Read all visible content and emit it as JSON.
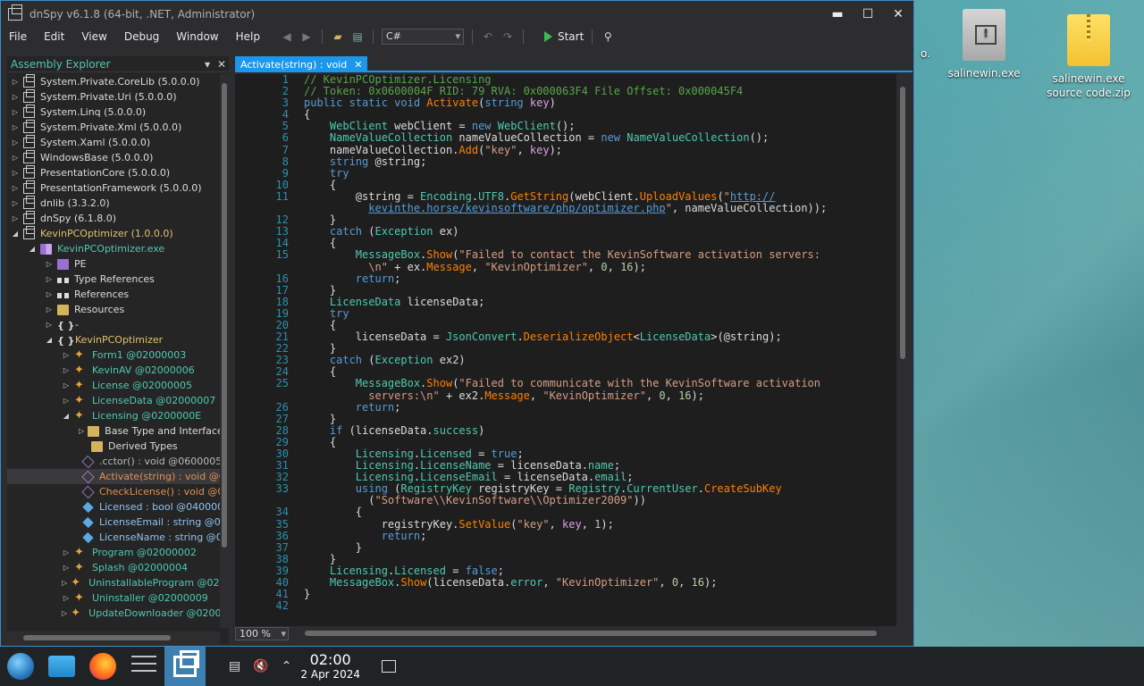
{
  "window": {
    "title": "dnSpy v6.1.8 (64-bit, .NET, Administrator)",
    "minimize": "▬",
    "maximize": "☐",
    "close": "✕"
  },
  "menu": [
    "File",
    "Edit",
    "View",
    "Debug",
    "Window",
    "Help"
  ],
  "toolbar": {
    "language": "C#",
    "start_label": "Start"
  },
  "explorer": {
    "title": "Assembly Explorer",
    "close": "✕",
    "nodes": [
      {
        "label": "System.Private.CoreLib (5.0.0.0)",
        "indent": 0,
        "arrow": "▷",
        "icon": "asm",
        "style": ""
      },
      {
        "label": "System.Private.Uri (5.0.0.0)",
        "indent": 0,
        "arrow": "▷",
        "icon": "asm",
        "style": ""
      },
      {
        "label": "System.Linq (5.0.0.0)",
        "indent": 0,
        "arrow": "▷",
        "icon": "asm",
        "style": ""
      },
      {
        "label": "System.Private.Xml (5.0.0.0)",
        "indent": 0,
        "arrow": "▷",
        "icon": "asm",
        "style": ""
      },
      {
        "label": "System.Xaml (5.0.0.0)",
        "indent": 0,
        "arrow": "▷",
        "icon": "asm",
        "style": ""
      },
      {
        "label": "WindowsBase (5.0.0.0)",
        "indent": 0,
        "arrow": "▷",
        "icon": "asm",
        "style": ""
      },
      {
        "label": "PresentationCore (5.0.0.0)",
        "indent": 0,
        "arrow": "▷",
        "icon": "asm",
        "style": ""
      },
      {
        "label": "PresentationFramework (5.0.0.0)",
        "indent": 0,
        "arrow": "▷",
        "icon": "asm",
        "style": ""
      },
      {
        "label": "dnlib (3.3.2.0)",
        "indent": 0,
        "arrow": "▷",
        "icon": "asm",
        "style": ""
      },
      {
        "label": "dnSpy (6.1.8.0)",
        "indent": 0,
        "arrow": "▷",
        "icon": "asm",
        "style": ""
      },
      {
        "label": "KevinPCOptimizer (1.0.0.0)",
        "indent": 0,
        "arrow": "◢",
        "icon": "asm",
        "style": "yel"
      },
      {
        "label": "KevinPCOptimizer.exe",
        "indent": 1,
        "arrow": "◢",
        "icon": "mod",
        "style": "mod"
      },
      {
        "label": "PE",
        "indent": 2,
        "arrow": "▷",
        "icon": "pe",
        "style": ""
      },
      {
        "label": "Type References",
        "indent": 2,
        "arrow": "▷",
        "icon": "ref",
        "style": ""
      },
      {
        "label": "References",
        "indent": 2,
        "arrow": "▷",
        "icon": "ref",
        "style": ""
      },
      {
        "label": "Resources",
        "indent": 2,
        "arrow": "▷",
        "icon": "folder",
        "style": ""
      },
      {
        "label": "-",
        "indent": 2,
        "arrow": "▷",
        "icon": "ns",
        "style": ""
      },
      {
        "label": "KevinPCOptimizer",
        "indent": 2,
        "arrow": "◢",
        "icon": "ns",
        "style": "yel"
      },
      {
        "label": "Form1 @02000003",
        "indent": 3,
        "arrow": "▷",
        "icon": "class",
        "style": "cls"
      },
      {
        "label": "KevinAV @02000006",
        "indent": 3,
        "arrow": "▷",
        "icon": "class",
        "style": "cls"
      },
      {
        "label": "License @02000005",
        "indent": 3,
        "arrow": "▷",
        "icon": "class",
        "style": "cls"
      },
      {
        "label": "LicenseData @02000007",
        "indent": 3,
        "arrow": "▷",
        "icon": "class",
        "style": "cls"
      },
      {
        "label": "Licensing @0200000E",
        "indent": 3,
        "arrow": "◢",
        "icon": "class",
        "style": "cls"
      },
      {
        "label": "Base Type and Interfaces",
        "indent": 4,
        "arrow": "▷",
        "icon": "folder",
        "style": ""
      },
      {
        "label": "Derived Types",
        "indent": 4,
        "arrow": "",
        "icon": "folder",
        "style": ""
      },
      {
        "label": ".cctor() : void @06000050",
        "indent": 4,
        "arrow": "",
        "icon": "method",
        "style": "gray"
      },
      {
        "label": "Activate(string) : void @0600004F",
        "indent": 4,
        "arrow": "",
        "icon": "method",
        "style": "orange",
        "selected": true
      },
      {
        "label": "CheckLicense() : void @0600004E",
        "indent": 4,
        "arrow": "",
        "icon": "method",
        "style": "orange"
      },
      {
        "label": "Licensed : bool @04000025",
        "indent": 4,
        "arrow": "",
        "icon": "field",
        "style": "field"
      },
      {
        "label": "LicenseEmail : string @04000027",
        "indent": 4,
        "arrow": "",
        "icon": "field",
        "style": "field"
      },
      {
        "label": "LicenseName : string @04000026",
        "indent": 4,
        "arrow": "",
        "icon": "field",
        "style": "field"
      },
      {
        "label": "Program @02000002",
        "indent": 3,
        "arrow": "▷",
        "icon": "class",
        "style": "cls"
      },
      {
        "label": "Splash @02000004",
        "indent": 3,
        "arrow": "▷",
        "icon": "class",
        "style": "cls"
      },
      {
        "label": "UninstallableProgram @0200000A",
        "indent": 3,
        "arrow": "▷",
        "icon": "class",
        "style": "cls"
      },
      {
        "label": "Uninstaller @02000009",
        "indent": 3,
        "arrow": "▷",
        "icon": "class",
        "style": "cls"
      },
      {
        "label": "UpdateDownloader @0200000B",
        "indent": 3,
        "arrow": "▷",
        "icon": "class",
        "style": "cls"
      }
    ]
  },
  "tab": {
    "label": "Activate(string) : void",
    "close": "✕"
  },
  "editor": {
    "zoom": "100 %",
    "lines": [
      {
        "n": "1",
        "html": "<span class='cm'>// KevinPCOptimizer.Licensing</span>"
      },
      {
        "n": "2",
        "html": "<span class='cm'>// Token: 0x0600004F RID: 79 RVA: 0x000063F4 File Offset: 0x000045F4</span>"
      },
      {
        "n": "3",
        "html": "<span class='k'>public static void</span> <span class='mo'>Activate</span>(<span class='k'>string</span> <span class='p'>key</span>)"
      },
      {
        "n": "4",
        "html": "{"
      },
      {
        "n": "5",
        "html": "    <span class='t'>WebClient</span> webClient = <span class='k'>new</span> <span class='t'>WebClient</span>();"
      },
      {
        "n": "6",
        "html": "    <span class='t'>NameValueCollection</span> nameValueCollection = <span class='k'>new</span> <span class='t'>NameValueCollection</span>();"
      },
      {
        "n": "7",
        "html": "    nameValueCollection.<span class='mo'>Add</span>(<span class='s'>\"key\"</span>, <span class='p'>key</span>);"
      },
      {
        "n": "8",
        "html": "    <span class='k'>string</span> @string;"
      },
      {
        "n": "9",
        "html": "    <span class='k'>try</span>"
      },
      {
        "n": "10",
        "html": "    {"
      },
      {
        "n": "11",
        "html": "        @string = <span class='t'>Encoding</span>.<span class='prop'>UTF8</span>.<span class='mo'>GetString</span>(webClient.<span class='mo'>UploadValues</span>(<span class='s'>\"</span><span class='url'>http://</span>"
      },
      {
        "n": "",
        "html": "          <span class='url'>kevinthe.horse/kevinsoftware/php/optimizer.php</span><span class='s'>\"</span>, nameValueCollection));"
      },
      {
        "n": "12",
        "html": "    }"
      },
      {
        "n": "13",
        "html": "    <span class='k'>catch</span> (<span class='t'>Exception</span> ex)"
      },
      {
        "n": "14",
        "html": "    {"
      },
      {
        "n": "15",
        "html": "        <span class='t'>MessageBox</span>.<span class='mo'>Show</span>(<span class='s'>\"Failed to contact the KevinSoftware activation servers:</span>"
      },
      {
        "n": "",
        "html": "          <span class='s'>\\n\"</span> + ex.<span class='mo'>Message</span>, <span class='s'>\"KevinOptimizer\"</span>, <span class='n'>0</span>, <span class='n'>16</span>);"
      },
      {
        "n": "16",
        "html": "        <span class='k'>return</span>;"
      },
      {
        "n": "17",
        "html": "    }"
      },
      {
        "n": "18",
        "html": "    <span class='t'>LicenseData</span> licenseData;"
      },
      {
        "n": "19",
        "html": "    <span class='k'>try</span>"
      },
      {
        "n": "20",
        "html": "    {"
      },
      {
        "n": "21",
        "html": "        licenseData = <span class='t'>JsonConvert</span>.<span class='mo'>DeserializeObject</span>&lt;<span class='t'>LicenseData</span>&gt;(@string);"
      },
      {
        "n": "22",
        "html": "    }"
      },
      {
        "n": "23",
        "html": "    <span class='k'>catch</span> (<span class='t'>Exception</span> ex2)"
      },
      {
        "n": "24",
        "html": "    {"
      },
      {
        "n": "25",
        "html": "        <span class='t'>MessageBox</span>.<span class='mo'>Show</span>(<span class='s'>\"Failed to communicate with the KevinSoftware activation</span>"
      },
      {
        "n": "",
        "html": "          <span class='s'>servers:\\n\"</span> + ex2.<span class='mo'>Message</span>, <span class='s'>\"KevinOptimizer\"</span>, <span class='n'>0</span>, <span class='n'>16</span>);"
      },
      {
        "n": "26",
        "html": "        <span class='k'>return</span>;"
      },
      {
        "n": "27",
        "html": "    }"
      },
      {
        "n": "28",
        "html": "    <span class='k'>if</span> (licenseData.<span class='prop'>success</span>)"
      },
      {
        "n": "29",
        "html": "    {"
      },
      {
        "n": "30",
        "html": "        <span class='t'>Licensing</span>.<span class='prop'>Licensed</span> = <span class='k'>true</span>;"
      },
      {
        "n": "31",
        "html": "        <span class='t'>Licensing</span>.<span class='prop'>LicenseName</span> = licenseData.<span class='prop'>name</span>;"
      },
      {
        "n": "32",
        "html": "        <span class='t'>Licensing</span>.<span class='prop'>LicenseEmail</span> = licenseData.<span class='prop'>email</span>;"
      },
      {
        "n": "33",
        "html": "        <span class='k'>using</span> (<span class='t'>RegistryKey</span> registryKey = <span class='t'>Registry</span>.<span class='prop'>CurrentUser</span>.<span class='mo'>CreateSubKey</span>"
      },
      {
        "n": "",
        "html": "          (<span class='s'>\"Software\\\\KevinSoftware\\\\Optimizer2009\"</span>))"
      },
      {
        "n": "34",
        "html": "        {"
      },
      {
        "n": "35",
        "html": "            registryKey.<span class='mo'>SetValue</span>(<span class='s'>\"key\"</span>, <span class='p'>key</span>, <span class='n'>1</span>);"
      },
      {
        "n": "36",
        "html": "            <span class='k'>return</span>;"
      },
      {
        "n": "37",
        "html": "        }"
      },
      {
        "n": "38",
        "html": "    }"
      },
      {
        "n": "39",
        "html": "    <span class='t'>Licensing</span>.<span class='prop'>Licensed</span> = <span class='k'>false</span>;"
      },
      {
        "n": "40",
        "html": "    <span class='t'>MessageBox</span>.<span class='mo'>Show</span>(licenseData.<span class='prop'>error</span>, <span class='s'>\"KevinOptimizer\"</span>, <span class='n'>0</span>, <span class='n'>16</span>);"
      },
      {
        "n": "41",
        "html": "}"
      },
      {
        "n": "42",
        "html": ""
      }
    ]
  },
  "desktop": {
    "icons": [
      {
        "label": "salinewin.exe",
        "kind": "gray"
      },
      {
        "label": "salinewin.exe source code.zip",
        "kind": "zip"
      }
    ],
    "edge_label": "o."
  },
  "taskbar": {
    "time": "02:00",
    "date": "2 Apr 2024"
  }
}
